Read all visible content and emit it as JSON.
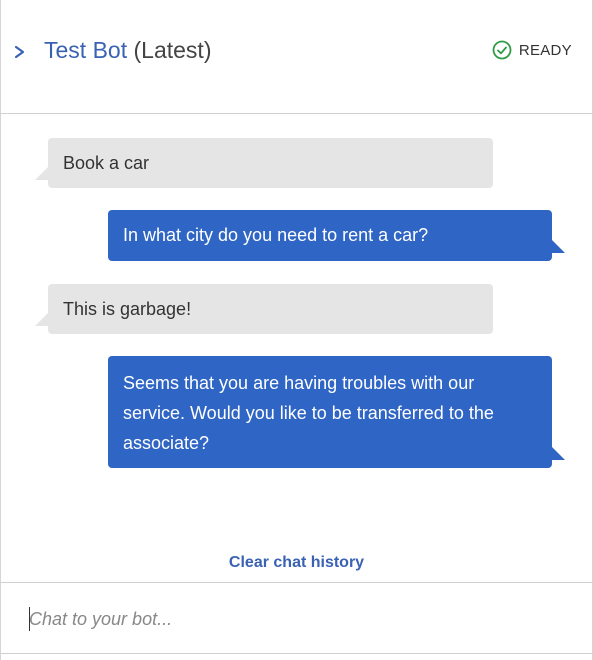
{
  "header": {
    "bot_name": "Test Bot",
    "version": "(Latest)",
    "status": "READY",
    "status_icon": "check-circle-icon",
    "expand_icon": "chevron-right-icon"
  },
  "colors": {
    "accent": "#3a62b3",
    "bot_bubble": "#2f65c4",
    "user_bubble": "#e5e5e5",
    "status_ok": "#2e9b47"
  },
  "messages": [
    {
      "sender": "user",
      "text": "Book a car"
    },
    {
      "sender": "bot",
      "text": "In what city do you need to rent a car?"
    },
    {
      "sender": "user",
      "text": "This is garbage!"
    },
    {
      "sender": "bot",
      "text": "Seems that you are having troubles with our service. Would you like to be transferred to the associate?"
    }
  ],
  "clear_history_label": "Clear chat history",
  "input": {
    "placeholder": "Chat to your bot...",
    "value": ""
  }
}
